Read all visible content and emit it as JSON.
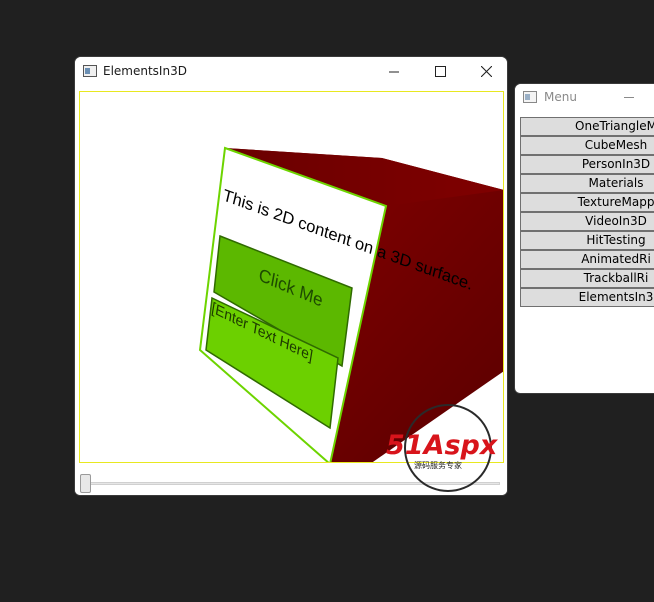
{
  "main_window": {
    "title": "ElementsIn3D",
    "content": {
      "surface_text": "This is 2D content on a 3D surface.",
      "button_label": "Click Me",
      "textbox_value": "[Enter Text Here]"
    },
    "slider_value": 0
  },
  "menu_window": {
    "title": "Menu",
    "items": [
      {
        "label": "OneTriangleM"
      },
      {
        "label": "CubeMesh"
      },
      {
        "label": "PersonIn3D"
      },
      {
        "label": "Materials"
      },
      {
        "label": "TextureMapp"
      },
      {
        "label": "VideoIn3D"
      },
      {
        "label": "HitTesting"
      },
      {
        "label": "AnimatedRi"
      },
      {
        "label": "TrackballRi"
      },
      {
        "label": "ElementsIn3"
      }
    ]
  },
  "watermark": {
    "brand": "51Aspx",
    "tagline": "源码服务专家"
  },
  "colors": {
    "desktop": "#202020",
    "cube_face": "#7a0000",
    "panel_green": "#5cb800",
    "viewport_border": "#e8e820",
    "watermark_red": "#d8141b"
  }
}
